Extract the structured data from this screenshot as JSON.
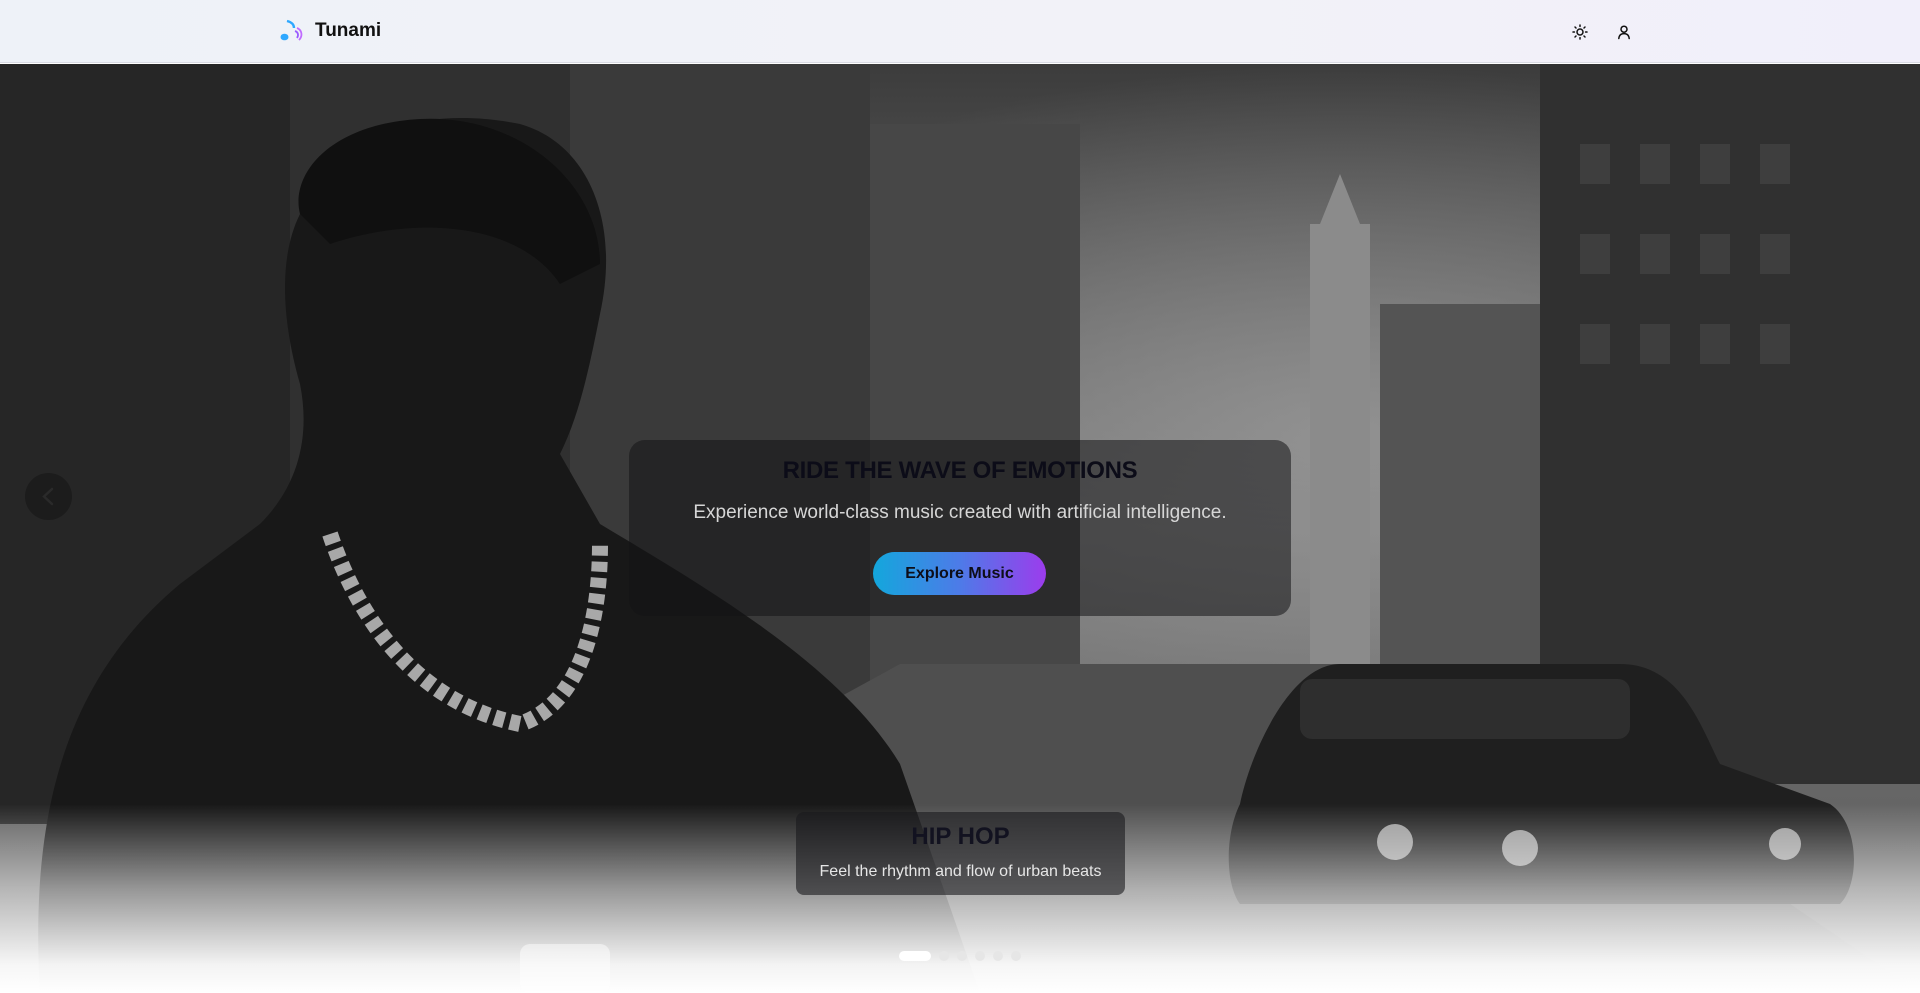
{
  "header": {
    "brand_name": "Tunami",
    "logo_icon": "music-note-icon",
    "theme_toggle_icon": "sun-icon",
    "account_icon": "user-icon"
  },
  "hero": {
    "title": "RIDE THE WAVE OF EMOTIONS",
    "subtitle": "Experience world-class music created with artificial intelligence.",
    "cta_label": "Explore Music",
    "background_image": "man-with-chain-in-city-street-with-car",
    "prev_icon": "chevron-left-icon"
  },
  "slide": {
    "genre_title": "HIP HOP",
    "genre_subtitle": "Feel the rhythm and flow of urban beats"
  },
  "carousel": {
    "slide_count": 6,
    "active_index": 0
  },
  "colors": {
    "accent_start": "#13a7dc",
    "accent_end": "#9c3cec",
    "logo_blue": "#2ea8ff",
    "logo_purple": "#9b5cff"
  }
}
